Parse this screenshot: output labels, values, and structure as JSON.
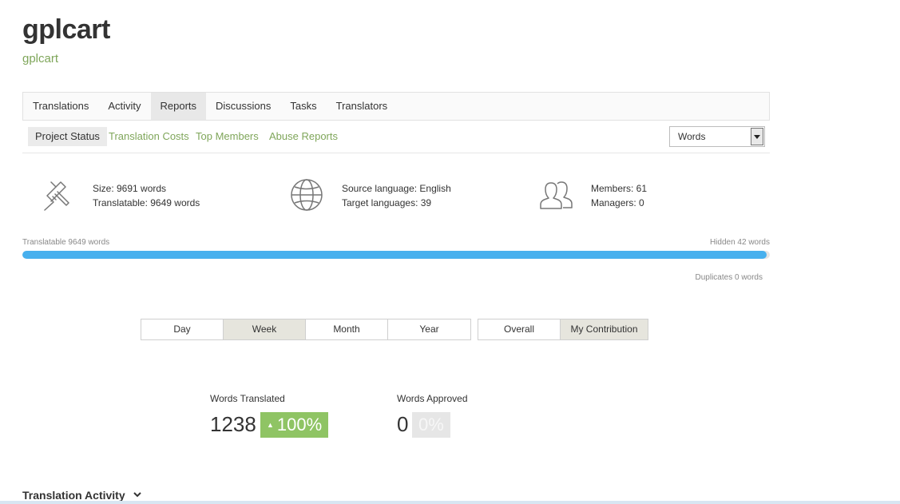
{
  "project": {
    "title": "gplcart",
    "subtitle": "gplcart"
  },
  "tabs": [
    {
      "label": "Translations",
      "active": false
    },
    {
      "label": "Activity",
      "active": false
    },
    {
      "label": "Reports",
      "active": true
    },
    {
      "label": "Discussions",
      "active": false
    },
    {
      "label": "Tasks",
      "active": false
    },
    {
      "label": "Translators",
      "active": false
    }
  ],
  "subtabs": [
    {
      "label": "Project Status",
      "active": true
    },
    {
      "label": "Translation Costs",
      "active": false
    },
    {
      "label": "Top Members",
      "active": false
    },
    {
      "label": "Abuse Reports",
      "active": false
    }
  ],
  "unit_select": {
    "value": "Words"
  },
  "stats": {
    "size": "Size: 9691 words",
    "translatable": "Translatable: 9649 words",
    "source_language": "Source language: English",
    "target_languages": "Target languages: 39",
    "members": "Members: 61",
    "managers": "Managers: 0"
  },
  "progress": {
    "left_label": "Translatable 9649 words",
    "right_label": "Hidden 42 words",
    "duplicates_label": "Duplicates 0 words",
    "translatable_fraction": 0.9957
  },
  "period_buttons": [
    {
      "label": "Day",
      "active": false
    },
    {
      "label": "Week",
      "active": true
    },
    {
      "label": "Month",
      "active": false
    },
    {
      "label": "Year",
      "active": false
    }
  ],
  "scope_buttons": [
    {
      "label": "Overall",
      "active": false
    },
    {
      "label": "My Contribution",
      "active": true
    }
  ],
  "metrics": {
    "translated": {
      "label": "Words Translated",
      "value": "1238",
      "change": "100%",
      "trend_icon": "triangle-up-icon"
    },
    "approved": {
      "label": "Words Approved",
      "value": "0",
      "change": "0%"
    }
  },
  "section": {
    "title": "Translation Activity"
  },
  "colors": {
    "accent_green": "#7fa65a",
    "progress_blue": "#47b0ee",
    "badge_green": "#8fc464"
  }
}
